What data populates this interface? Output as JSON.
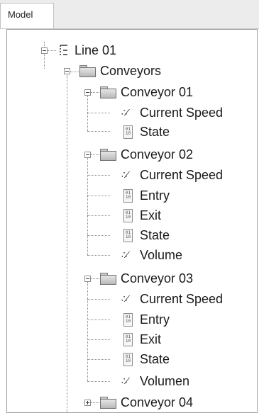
{
  "tab": {
    "label": "Model"
  },
  "tree": {
    "root": "Line 01",
    "folder": "Conveyors",
    "conveyor1": {
      "label": "Conveyor 01",
      "items": [
        "Current Speed",
        "State"
      ]
    },
    "conveyor2": {
      "label": "Conveyor 02",
      "items": [
        "Current Speed",
        "Entry",
        "Exit",
        "State",
        "Volume"
      ]
    },
    "conveyor3": {
      "label": "Conveyor 03",
      "items": [
        "Current Speed",
        "Entry",
        "Exit",
        "State",
        "Volumen"
      ]
    },
    "conveyor4": {
      "label": "Conveyor 04"
    }
  },
  "icons": {
    "root": "line-tree-icon",
    "folder": "folder-icon",
    "speed": "speed-gauge-icon",
    "binary": "binary-document-icon"
  }
}
